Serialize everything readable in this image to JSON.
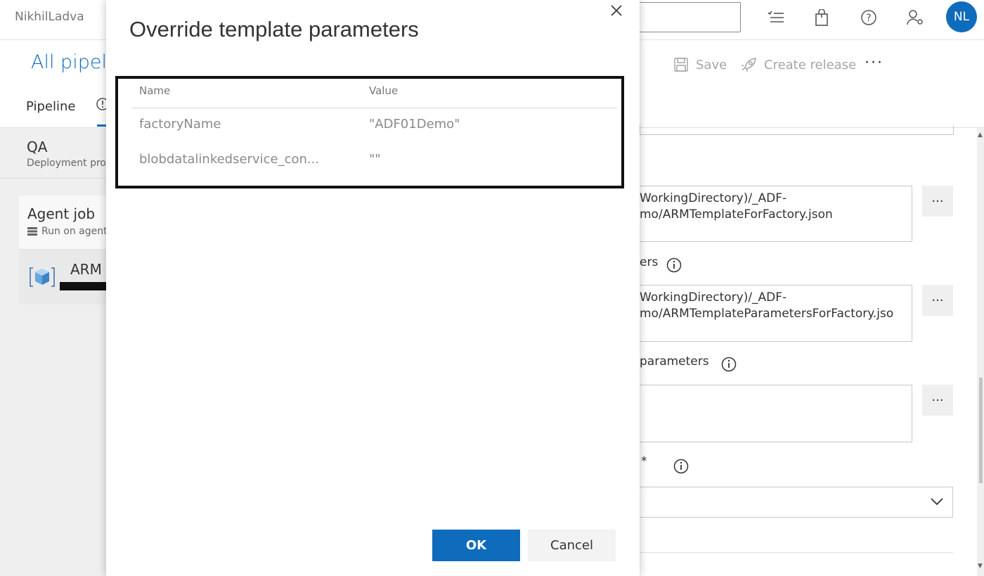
{
  "header": {
    "org": "NikhilLadva",
    "separator": "/",
    "avatar_initials": "NL",
    "icons": [
      "checklist-icon",
      "shopping-bag-icon",
      "help-icon",
      "user-settings-icon"
    ]
  },
  "subheader": {
    "title": "All pipeli",
    "tabs": [
      {
        "label": "Pipeline"
      }
    ],
    "save_label": "Save",
    "create_release_label": "Create release",
    "more_label": "···"
  },
  "stage": {
    "name": "QA",
    "subtitle": "Deployment proc"
  },
  "agent_job": {
    "title": "Agent job",
    "subtitle": "Run on agent"
  },
  "task": {
    "name": "ARM"
  },
  "right_panel": {
    "template_path_line1": "WorkingDirectory)/_ADF-",
    "template_path_line2": "mo/ARMTemplateForFactory.json",
    "params_label_fragment": "ers",
    "params_path_line1": "WorkingDirectory)/_ADF-",
    "params_path_line2": "mo/ARMTemplateParametersForFactory.jso",
    "override_label_fragment": "parameters",
    "required_marker": "*",
    "dots_label": "···"
  },
  "dialog": {
    "title": "Override template parameters",
    "columns": {
      "name": "Name",
      "value": "Value"
    },
    "rows": [
      {
        "name": "factoryName",
        "value": "\"ADF01Demo\""
      },
      {
        "name": "blobdatalinkedservice_con...",
        "value": "\"\""
      }
    ],
    "ok_label": "OK",
    "cancel_label": "Cancel"
  },
  "colors": {
    "accent": "#0f6cbd",
    "highlight_border": "#111111"
  }
}
